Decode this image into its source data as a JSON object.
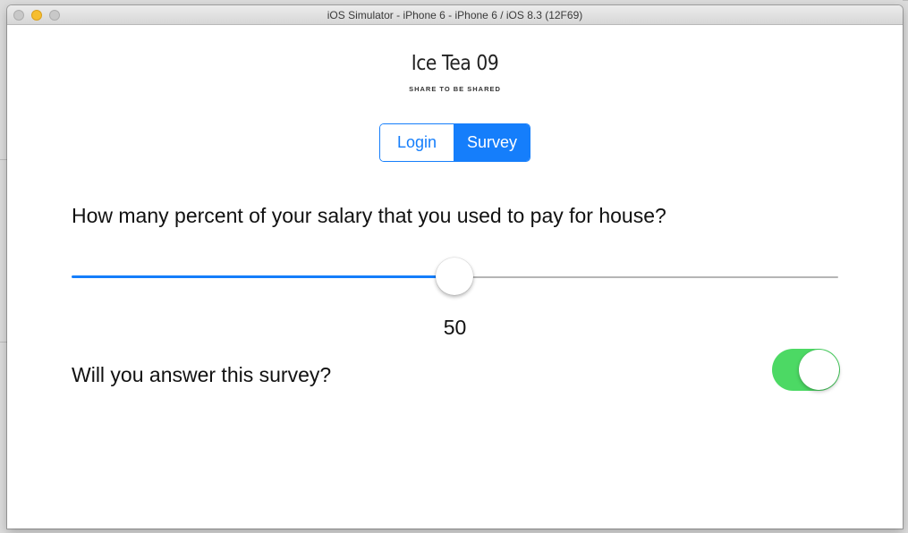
{
  "window": {
    "title": "iOS Simulator - iPhone 6 - iPhone 6 / iOS 8.3 (12F69)"
  },
  "app": {
    "name": "Ice Tea 09",
    "tagline": "SHARE TO BE SHARED"
  },
  "segmented_control": {
    "segments": [
      {
        "label": "Login",
        "selected": false
      },
      {
        "label": "Survey",
        "selected": true
      }
    ]
  },
  "survey": {
    "question": "How many percent of your salary that you used to pay for house?",
    "slider": {
      "value": 50,
      "min": 0,
      "max": 100
    },
    "value_label": "50",
    "toggle_question": "Will you answer this survey?",
    "toggle_on": true
  },
  "colors": {
    "accent": "#157efb",
    "switch_on": "#4cd964",
    "track_off": "#b5b5b5"
  }
}
